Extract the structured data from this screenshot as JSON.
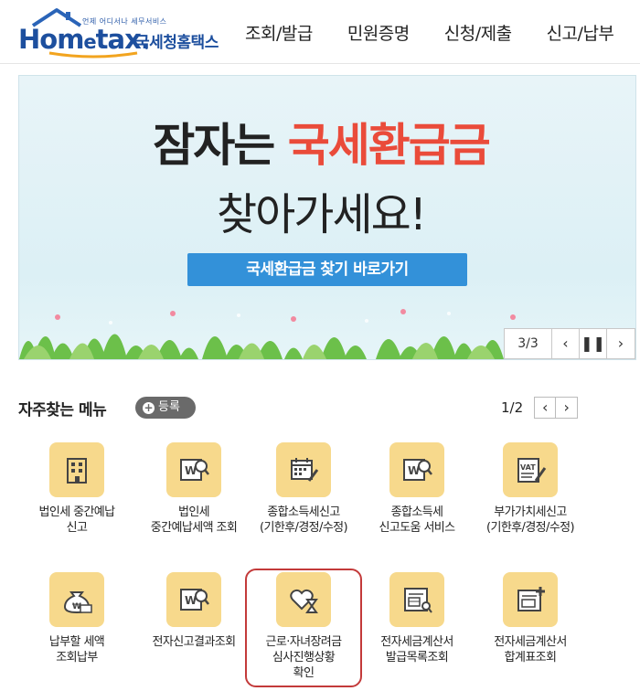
{
  "header": {
    "logo_small": "언제 어디서나 세무서비스",
    "logo_main_1": "Hom",
    "logo_main_e": "e",
    "logo_main_2": "tax.",
    "logo_sub": "국세청홈택스",
    "nav": [
      "조회/발급",
      "민원증명",
      "신청/제출",
      "신고/납부"
    ]
  },
  "banner": {
    "line1_prefix": "잠자는 ",
    "line1_highlight": "국세환급금",
    "line2": "찾아가세요!",
    "button": "국세환급금 찾기 바로가기",
    "page": "3/3",
    "prev_icon": "chevron-left-icon",
    "pause_icon": "pause-icon",
    "next_icon": "chevron-right-icon",
    "highlight_color": "#ea4b3a",
    "button_color": "#3391d9"
  },
  "favorites": {
    "title": "자주찾는 메뉴",
    "register": "등록",
    "page": "1/2",
    "items": [
      {
        "line1": "법인세 중간예납",
        "line2": "신고",
        "line3": "",
        "icon": "building-icon"
      },
      {
        "line1": "법인세",
        "line2": "중간예납세액 조회",
        "line3": "",
        "icon": "won-document-search-icon"
      },
      {
        "line1": "종합소득세신고",
        "line2": "(기한후/경정/수정)",
        "line3": "",
        "icon": "calendar-pen-icon"
      },
      {
        "line1": "종합소득세",
        "line2": "신고도움 서비스",
        "line3": "",
        "icon": "won-document-search-icon"
      },
      {
        "line1": "부가가치세신고",
        "line2": "(기한후/경정/수정)",
        "line3": "",
        "icon": "vat-document-icon"
      },
      {
        "line1": "납부할 세액",
        "line2": "조회납부",
        "line3": "",
        "icon": "money-bag-icon"
      },
      {
        "line1": "전자신고결과조회",
        "line2": "",
        "line3": "",
        "icon": "won-document-search-icon"
      },
      {
        "line1": "근로·자녀장려금",
        "line2": "심사진행상황",
        "line3": "확인",
        "icon": "heart-hourglass-icon"
      },
      {
        "line1": "전자세금계산서",
        "line2": "발급목록조회",
        "line3": "",
        "icon": "invoice-search-icon"
      },
      {
        "line1": "전자세금계산서",
        "line2": "합계표조회",
        "line3": "",
        "icon": "invoice-plus-icon"
      }
    ]
  }
}
